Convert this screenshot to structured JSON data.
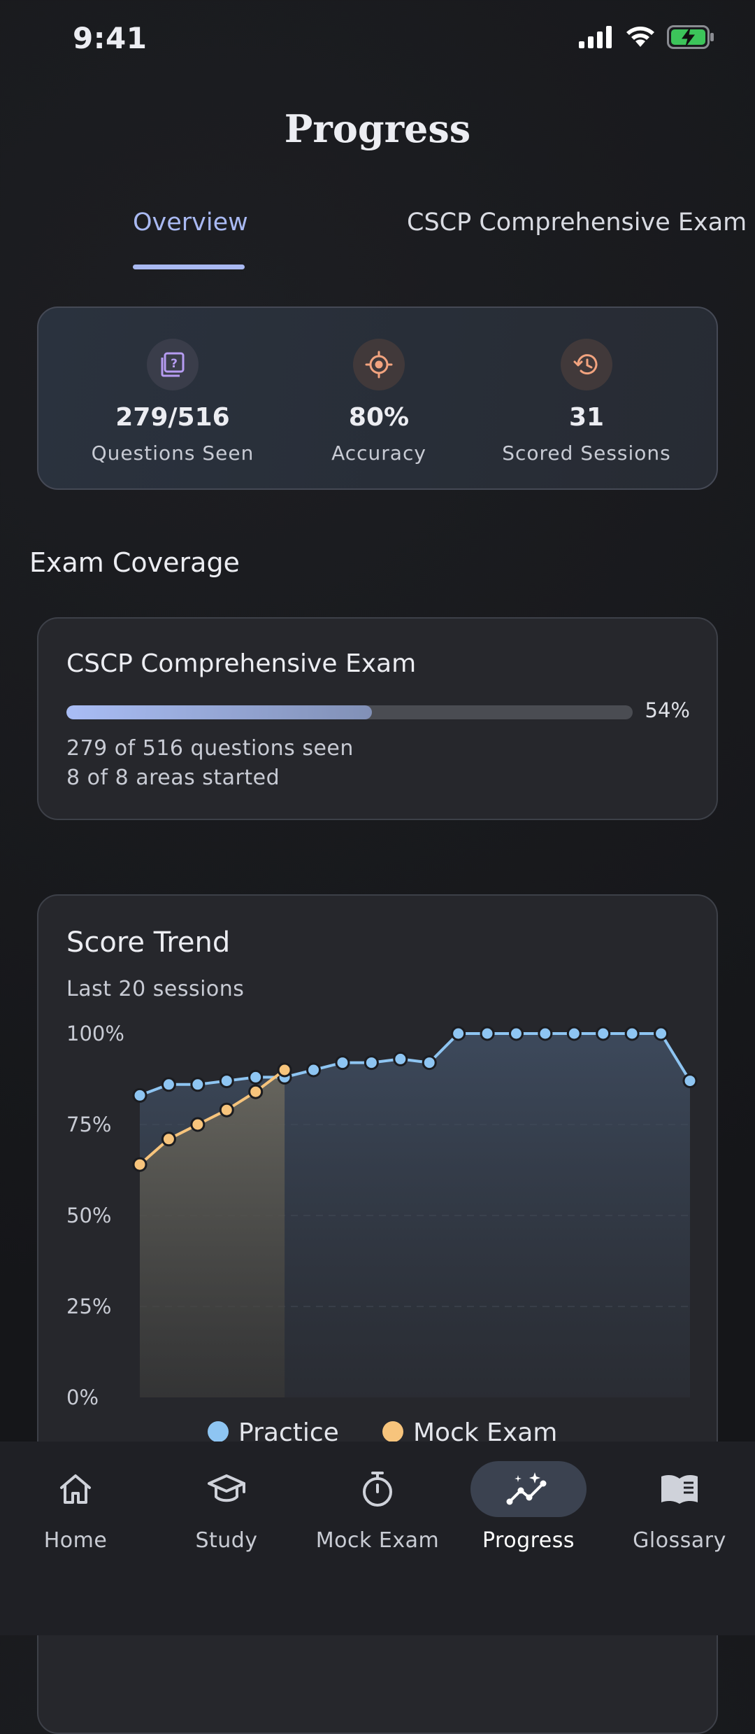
{
  "status_bar": {
    "time": "9:41"
  },
  "header": {
    "title": "Progress"
  },
  "tabs": [
    {
      "label": "Overview",
      "active": true
    },
    {
      "label": "CSCP Comprehensive Exam",
      "active": false
    }
  ],
  "stats": [
    {
      "icon": "question-icon",
      "value": "279/516",
      "label": "Questions Seen",
      "color": "#b69cf2"
    },
    {
      "icon": "target-icon",
      "value": "80%",
      "label": "Accuracy",
      "color": "#f2a37f"
    },
    {
      "icon": "history-icon",
      "value": "31",
      "label": "Scored Sessions",
      "color": "#f2a37f"
    }
  ],
  "coverage": {
    "section_title": "Exam Coverage",
    "exam_name": "CSCP Comprehensive Exam",
    "progress": 0.54,
    "percent_label": "54%",
    "questions_line": "279 of 516 questions seen",
    "areas_line": "8 of 8 areas started"
  },
  "chart_data": {
    "type": "line",
    "title": "Score Trend",
    "subtitle": "Last 20 sessions",
    "y_ticks": [
      "100%",
      "75%",
      "50%",
      "25%",
      "0%"
    ],
    "ylim": [
      0,
      100
    ],
    "x": [
      1,
      2,
      3,
      4,
      5,
      6,
      7,
      8,
      9,
      10,
      11,
      12,
      13,
      14,
      15,
      16,
      17,
      18,
      19,
      20
    ],
    "series": [
      {
        "name": "Practice",
        "color": "#8ec5f2",
        "values": [
          83,
          86,
          86,
          87,
          88,
          88,
          90,
          92,
          92,
          93,
          92,
          100,
          100,
          100,
          100,
          100,
          100,
          100,
          100,
          87
        ]
      },
      {
        "name": "Mock Exam",
        "color": "#f7c47c",
        "values": [
          64,
          71,
          75,
          79,
          84,
          90,
          null,
          null,
          null,
          null,
          null,
          null,
          null,
          null,
          null,
          null,
          null,
          null,
          null,
          null
        ]
      }
    ],
    "legend": "bottom",
    "grid": true
  },
  "nav": [
    {
      "label": "Home",
      "icon": "home-icon",
      "active": false
    },
    {
      "label": "Study",
      "icon": "graduation-cap-icon",
      "active": false
    },
    {
      "label": "Mock Exam",
      "icon": "stopwatch-icon",
      "active": false
    },
    {
      "label": "Progress",
      "icon": "trend-sparkle-icon",
      "active": true
    },
    {
      "label": "Glossary",
      "icon": "book-icon",
      "active": false
    }
  ]
}
